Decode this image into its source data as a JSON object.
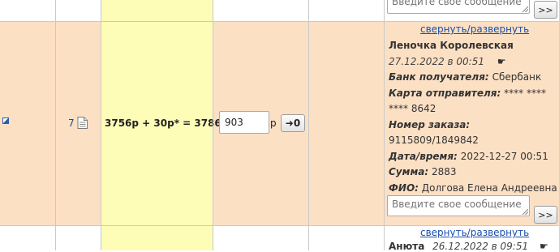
{
  "top_row": {
    "message_placeholder": "Введите свое сообщение",
    "send_label": ">>"
  },
  "main_row": {
    "order_number": "7",
    "calculation": "3756р + 30р* = 3786р",
    "amount_value": "903",
    "currency": "р",
    "zero_button_label": "➜0",
    "toggle_link": "свернуть/развернуть",
    "sender_name": "Леночка Королевская",
    "date": "27.12.2022 в 00:51",
    "pointer_icon": "☛",
    "details": [
      {
        "label": "Банк получателя:",
        "value": "Сбербанк"
      },
      {
        "label": "Карта отправителя:",
        "value": "**** **** **** 8642"
      },
      {
        "label": "Номер заказа:",
        "value": "9115809/1849842"
      },
      {
        "label": "Дата/время:",
        "value": "2022-12-27 00:51"
      },
      {
        "label": "Сумма:",
        "value": "2883"
      },
      {
        "label": "ФИО:",
        "value": "Долгова Елена Андреевна"
      }
    ],
    "message_placeholder": "Введите свое сообщение",
    "send_label": ">>"
  },
  "bottom_row": {
    "toggle_link": "свернуть/развернуть",
    "sender_name": "Анюта",
    "date": "26.12.2022 в 09:51",
    "pointer_icon": "☛"
  },
  "colors": {
    "row_highlight": "#fce0c4",
    "yellow_column": "#fdfdb8",
    "link": "#1a4ea8"
  }
}
